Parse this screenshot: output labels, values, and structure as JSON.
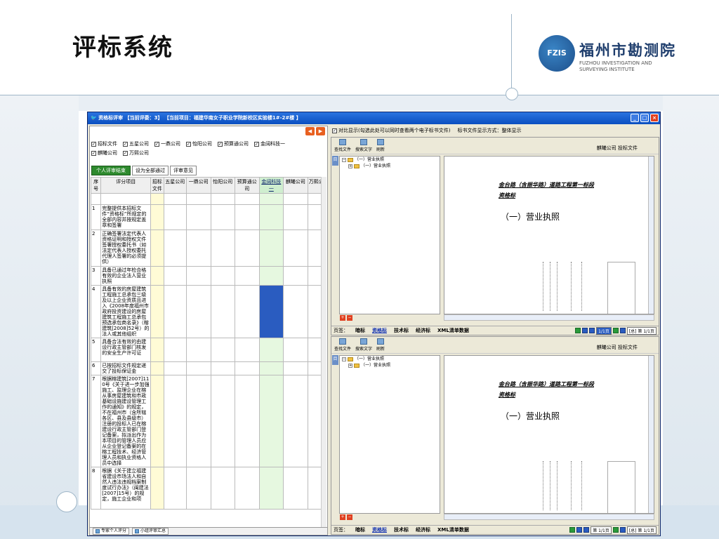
{
  "slide": {
    "title": "评标系统"
  },
  "logo": {
    "mark": "FZIS",
    "cn": "福州市勘测院",
    "en": "FUZHOU INVESTIGATION AND SURVEYING INSTITUTE"
  },
  "window": {
    "title": "资格标评审   【当前评委：3】  【当前项目：福建华南女子职业学院新校区实验楼1#-2#楼 】",
    "icon": "app-icon"
  },
  "left": {
    "companies_row1": [
      "招标文件",
      "五星公司",
      "一鼎公司",
      "怡阳公司",
      "预算通公司",
      "金阔科技一"
    ],
    "companies_row2": [
      "麒曦公司",
      "万熙公司"
    ],
    "buttons": {
      "individual_end": "个人评审结束",
      "set_all_pass": "设为全部通过",
      "review_opinion": "评审意见"
    },
    "columns": [
      "序号",
      "评分项目",
      "招标文件",
      "五星公司",
      "一鼎公司",
      "怡阳公司",
      "预算通公司",
      "金阔科技一",
      "麒曦公司",
      "万熙公"
    ],
    "rows": [
      {
        "no": "1",
        "item": "完整提供本招标文件“资格标”所规定的全部内容并按规定盖章和签署"
      },
      {
        "no": "2",
        "item": "正确签署法定代表人资格证明和授权文件签署授权委托书（如法定代表人授权委托代理人签署的必须提供）"
      },
      {
        "no": "3",
        "item": "具备已通过年检合格有效的企业法人营业执照"
      },
      {
        "no": "4",
        "item": "具备有效的房屋建筑工程施工总承包三级及以上企业资质且进入《2008年度福州市政府投资建设的房屋建筑工程施工总承包预选承包商名录》（榕建筑[2008]52号）的法人或其他组织"
      },
      {
        "no": "5",
        "item": "具备合法有效的由建设行政主管部门核发的安全生产许可证"
      },
      {
        "no": "6",
        "item": "已按招标文件规定递交了投标保证金"
      },
      {
        "no": "7",
        "item": "根据榕建筑[2007]110号《关于进一步加强施工、监理企业在榕从事房屋建筑和市政基础设施建设管理工作的通知》的规定，不在福州市（含所辖各区、县及县级市）注册的投标人已在榕建设行政主管部门登记备案，拟派出作为本项目的管理人员应从企业登记备案的在榕工程技术、经济管理人员和执业资格人员中选择"
      },
      {
        "no": "8",
        "item": "根据《关于建立福建省建设市场法人和自然人违法违规档案制度试行办法》（闽建法[2007]15号）的规定，施工企业和项"
      }
    ],
    "bottom_tabs": [
      "专家个人评分",
      "小组评审汇总"
    ]
  },
  "right": {
    "compare_label": "对比显示(勾选此处可以同时查看两个电子标书文件)",
    "display_mode": "标书文件显示方式：整体显示",
    "tools": [
      "查找文件",
      "搜索文字",
      "刷新"
    ],
    "top_pane": {
      "doc_label": "麒曦公司  投标文件",
      "tree_root": "（一）营业执照",
      "tree_child": "（一）营业执照"
    },
    "bottom_pane": {
      "doc_label": "麒曦公司  投标文件",
      "tree_root": "（一）营业执照",
      "tree_child": "（一）营业执照"
    },
    "doc_heading": "金台路（含振华路）道路工程第一标段",
    "doc_heading2": "资格标",
    "doc_section": "（一）营业执照",
    "page_tabs": [
      "页签：",
      "暗标",
      "资格标",
      "技术标",
      "经济标",
      "XML清单数据"
    ],
    "page_info_top": "1/1页",
    "page_info_bottom": "第 1/1页",
    "total_pages": "[总] 第 1/1页"
  }
}
